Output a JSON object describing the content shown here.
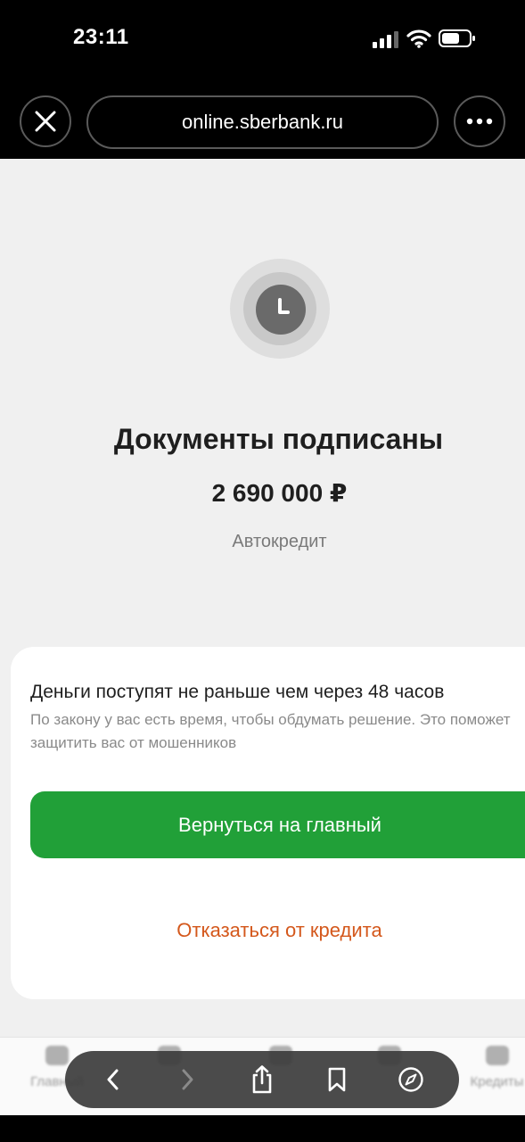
{
  "status_bar": {
    "time": "23:11"
  },
  "browser": {
    "url": "online.sberbank.ru"
  },
  "result": {
    "title": "Документы подписаны",
    "amount": "2 690 000 ₽",
    "product": "Автокредит"
  },
  "notice": {
    "heading": "Деньги поступят не раньше чем через 48 часов",
    "text": "По закону у вас есть время, чтобы обдумать решение. Это поможет защитить вас от мошенников"
  },
  "actions": {
    "primary_label": "Вернуться на главный",
    "secondary_label": "Отказаться от кредита"
  },
  "bottom_nav": {
    "items": [
      {
        "label": "Главный",
        "icon": "home-icon"
      },
      {
        "label": "",
        "icon": "grid-icon"
      },
      {
        "label": "",
        "icon": "gift-icon"
      },
      {
        "label": "",
        "icon": "card-icon"
      },
      {
        "label": "Кредиты",
        "icon": "wallet-icon"
      }
    ]
  },
  "colors": {
    "accent_green": "#21a038",
    "cancel_orange": "#d4581c"
  }
}
